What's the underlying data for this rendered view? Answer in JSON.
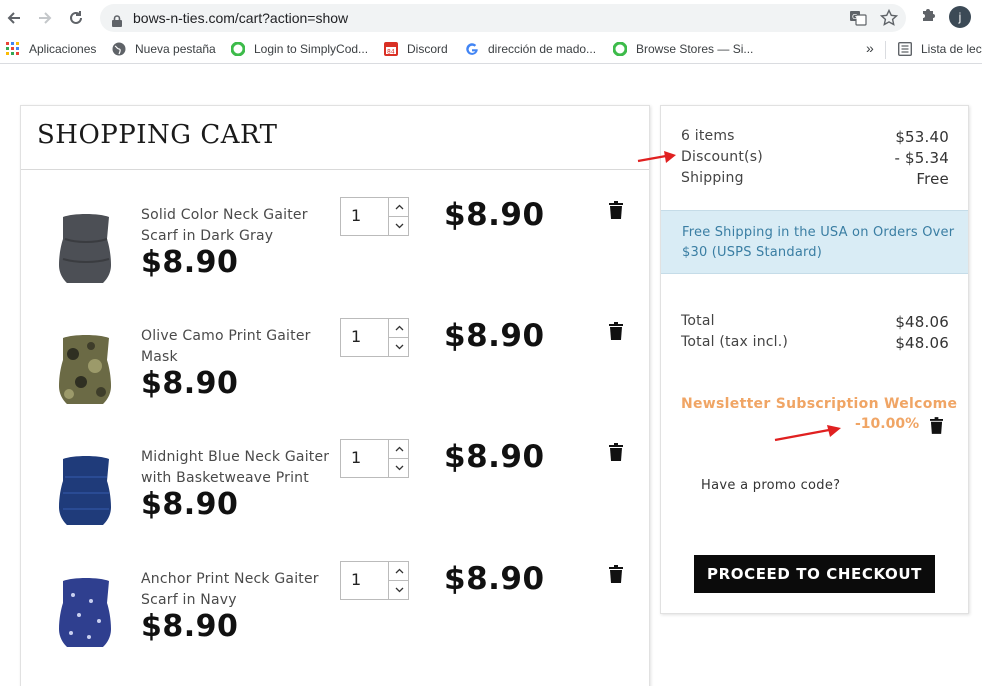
{
  "browser": {
    "url": "bows-n-ties.com/cart?action=show",
    "avatar_letter": "j",
    "bookmarks": [
      {
        "label": "Aplicaciones",
        "icon": "apps-grid-icon"
      },
      {
        "label": "Nueva pestaña",
        "icon": "globe-icon"
      },
      {
        "label": "Login to SimplyCod...",
        "icon": "green-circle-icon"
      },
      {
        "label": "Discord",
        "icon": "calendar-icon"
      },
      {
        "label": "dirección de mado...",
        "icon": "google-icon"
      },
      {
        "label": "Browse Stores — Si...",
        "icon": "green-circle-icon"
      }
    ],
    "overflow_label": "»",
    "reading_list": "Lista de lectura"
  },
  "cart": {
    "title": "SHOPPING CART",
    "items": [
      {
        "name": "Solid Color Neck Gaiter Scarf in Dark Gray",
        "price": "$8.90",
        "qty": "1",
        "line_total": "$8.90",
        "color": "#4c4f55"
      },
      {
        "name": "Olive Camo Print Gaiter Mask",
        "price": "$8.90",
        "qty": "1",
        "line_total": "$8.90",
        "color": "#6b6a45"
      },
      {
        "name": "Midnight Blue Neck Gaiter with Basketweave Print",
        "price": "$8.90",
        "qty": "1",
        "line_total": "$8.90",
        "color": "#1f3b7a"
      },
      {
        "name": "Anchor Print Neck Gaiter Scarf in Navy",
        "price": "$8.90",
        "qty": "1",
        "line_total": "$8.90",
        "color": "#2f3f8f"
      }
    ]
  },
  "summary": {
    "items_label": "6 items",
    "items_value": "$53.40",
    "discount_label": "Discount(s)",
    "discount_value": "- $5.34",
    "shipping_label": "Shipping",
    "shipping_value": "Free",
    "banner": "Free Shipping in the USA on Orders Over $30 (USPS Standard)",
    "total_label": "Total",
    "total_value": "$48.06",
    "total_tax_label": "Total (tax incl.)",
    "total_tax_value": "$48.06",
    "voucher_name": "Newsletter Subscription Welcome",
    "voucher_value": "-10.00%",
    "promo_label": "Have a promo code?",
    "checkout_label": "PROCEED TO CHECKOUT"
  },
  "colors": {
    "accent_orange": "#f0a565",
    "banner_bg": "#d9ecf5",
    "banner_text": "#3a7ea3",
    "annotation_red": "#e02020"
  }
}
